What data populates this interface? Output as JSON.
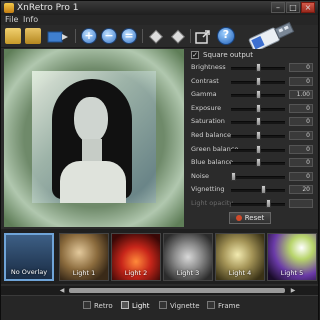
{
  "window": {
    "title": "XnRetro Pro 1"
  },
  "menu": [
    "File",
    "Info"
  ],
  "toolbar": [
    "open-icon",
    "open-folder-icon",
    "save-icon",
    "zoom-in-icon",
    "zoom-out-icon",
    "zoom-fit-icon",
    "rotate-left-icon",
    "rotate-right-icon",
    "export-icon",
    "help-icon"
  ],
  "settings": {
    "square_output": "Square output",
    "square_output_checked": true,
    "sliders": [
      {
        "label": "Brightness",
        "value": "0",
        "level": 0.5
      },
      {
        "label": "Contrast",
        "value": "0",
        "level": 0.5
      },
      {
        "label": "Gamma",
        "value": "1.00",
        "level": 0.5
      },
      {
        "label": "Exposure",
        "value": "0",
        "level": 0.5
      },
      {
        "label": "Saturation",
        "value": "0",
        "level": 0.5
      },
      {
        "label": "Red balance",
        "value": "0",
        "level": 0.5
      },
      {
        "label": "Green balance",
        "value": "0",
        "level": 0.5
      },
      {
        "label": "Blue balance",
        "value": "0",
        "level": 0.5
      },
      {
        "label": "Noise",
        "value": "0",
        "level": 0.0
      },
      {
        "label": "Vignetting",
        "value": "20",
        "level": 0.6
      },
      {
        "label": "Light opacity",
        "value": "",
        "level": 0.7,
        "disabled": true
      }
    ],
    "reset": "Reset"
  },
  "thumbnails": [
    {
      "label": "No Overlay",
      "selected": true
    },
    {
      "label": "Light 1"
    },
    {
      "label": "Light 2"
    },
    {
      "label": "Light 3"
    },
    {
      "label": "Light 4"
    },
    {
      "label": "Light 5"
    }
  ],
  "tabs": [
    {
      "label": "Retro"
    },
    {
      "label": "Light",
      "active": true
    },
    {
      "label": "Vignette"
    },
    {
      "label": "Frame"
    }
  ],
  "colors": {
    "accent": "#6fa4d8",
    "reset_icon": "#d24a2a"
  }
}
